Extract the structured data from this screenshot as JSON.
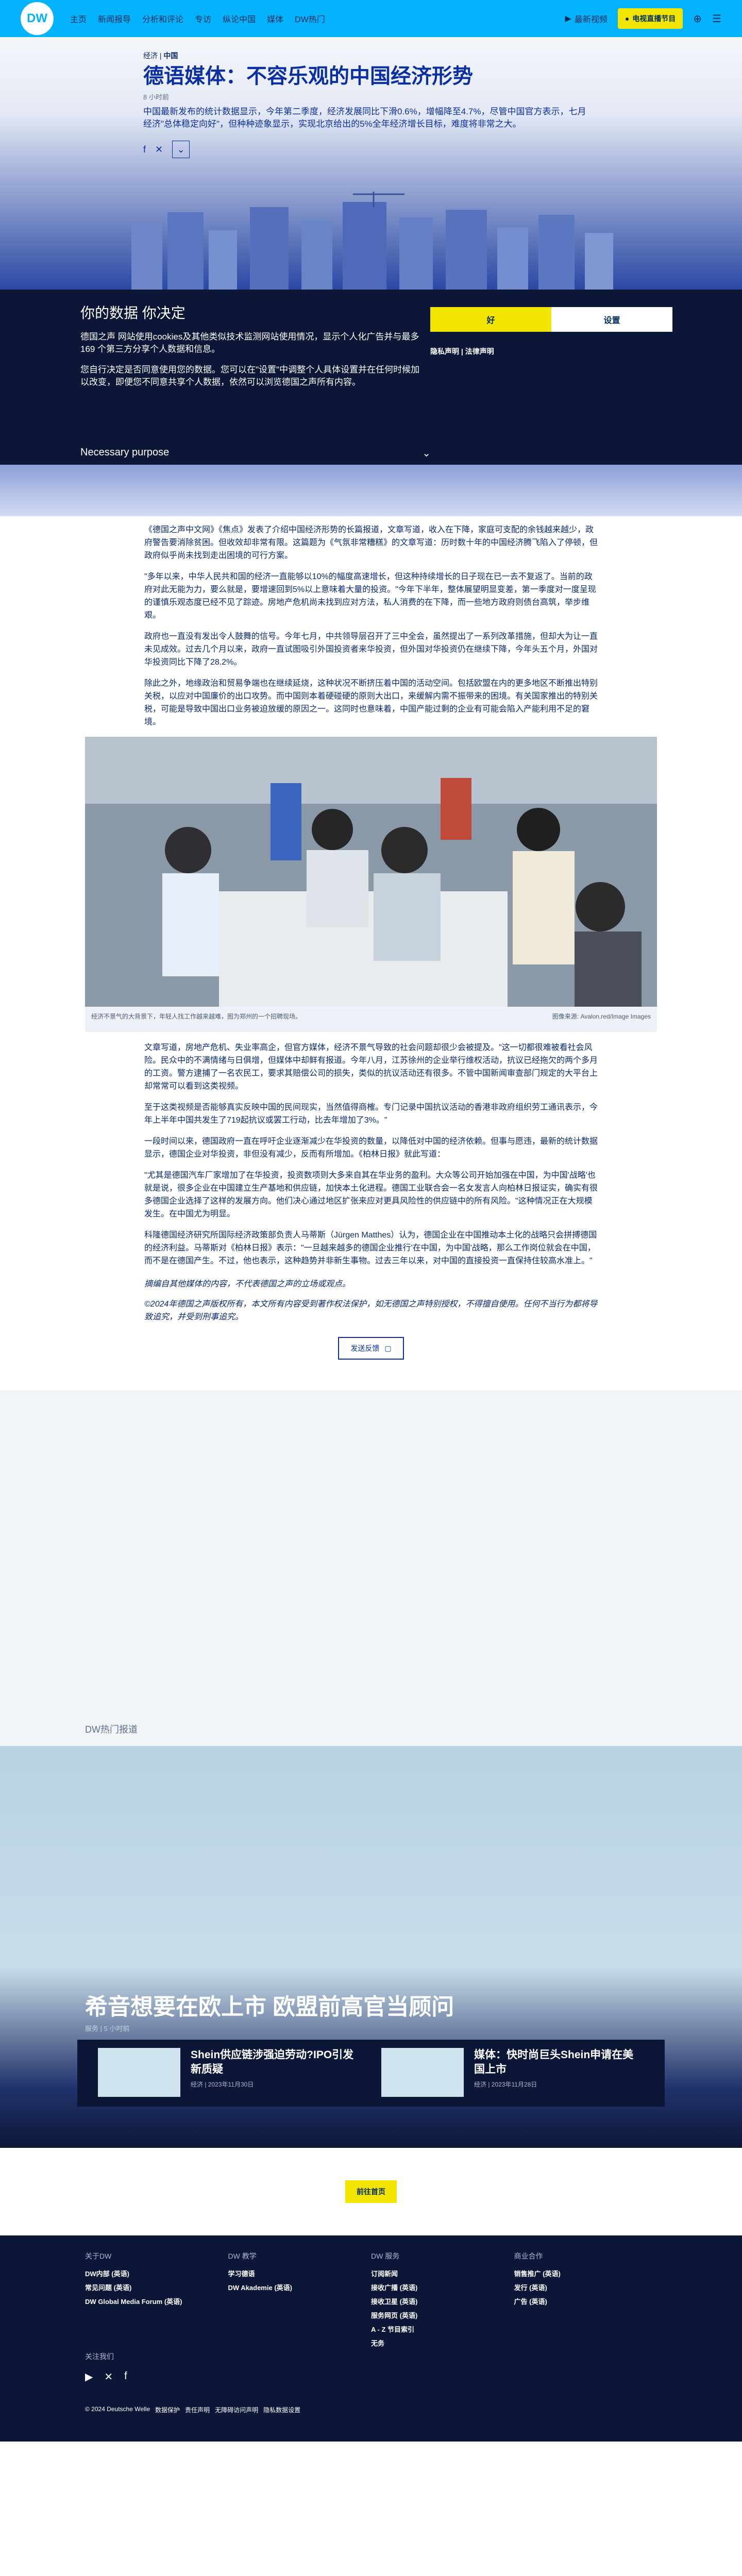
{
  "header": {
    "logo": "DW",
    "nav": [
      "主页",
      "新闻报导",
      "分析和评论",
      "专访",
      "纵论中国",
      "媒体",
      "DW热门"
    ],
    "latest": "最新视频",
    "live": "电视直播节目"
  },
  "article": {
    "kicker_section": "经济",
    "kicker_country": "中国",
    "title": "德语媒体：不容乐观的中国经济形势",
    "date": "8 小时前",
    "lede": "中国最新发布的统计数据显示，今年第二季度，经济发展同比下滑0.6%，增幅降至4.7%，尽管中国官方表示，七月经济\"总体稳定向好\"，但种种迹象显示，实现北京给出的5%全年经济增长目标，难度将非常之大。",
    "paragraphs": [
      "《德国之声中文网》《焦点》发表了介绍中国经济形势的长篇报道，文章写道，收入在下降，家庭可支配的余钱越来越少，政府警告要消除贫困。但收效却非常有限。这篇题为《气氛非常糟糕》的文章写道：历时数十年的中国经济腾飞陷入了停顿，但政府似乎尚未找到走出困境的可行方案。",
      "\"多年以来，中华人民共和国的经济一直能够以10%的幅度高速增长，但这种持续增长的日子现在已一去不复返了。当前的政府对此无能为力，要么就是，要增速回到5%以上意味着大量的投资。\"今年下半年，整体展望明显变差，第一季度对一度呈现的谨慎乐观态度已经不见了踪迹。房地产危机尚未找到应对方法，私人消费的在下降，而一些地方政府则债台高筑，举步维艰。",
      "政府也一直没有发出令人鼓舞的信号。今年七月，中共领导层召开了三中全会，虽然提出了一系列改革措施，但却大为让一直未见成效。过去几个月以来，政府一直试图吸引外国投资者来华投资，但外国对华投资仍在继续下降，今年头五个月，外国对华投资同比下降了28.2%。",
      "除此之外，地缘政治和贸易争端也在继续延烧，这种状况不断挤压着中国的活动空间。包括欧盟在内的更多地区不断推出特别关税，以应对中国廉价的出口攻势。而中国则本着硬碰硬的原则大出口，来缓解内需不振带来的困境。有关国家推出的特别关税，可能是导致中国出口业务被迫放缓的原因之一。这同时也意味着，中国产能过剩的企业有可能会陷入产能利用不足的窘境。"
    ],
    "photo_caption": "经济不景气的大背景下，年轻人找工作越来越难，图为郑州的一个招聘现场。",
    "photo_credit": "图像来源: Avalon.red/Image Images",
    "paragraphs2": [
      "文章写道，房地产危机、失业率高企，但官方媒体，经济不景气导致的社会问题却很少会被提及。\"这一切都很难被看社会风险。民众中的不满情绪与日俱增，但媒体中却鲜有报道。今年八月，江苏徐州的企业举行维权活动，抗议已经拖欠的两个多月的工资。警方逮捕了一名农民工，要求其赔偿公司的损失，类似的抗议活动还有很多。不管中国新闻审查部门规定的大平台上却常常可以看到这类视频。",
      "至于这类视频是否能够真实反映中国的民间现实，当然值得商榷。专门记录中国抗议活动的香港非政府组织劳工通讯表示，今年上半年中国共发生了719起抗议或罢工行动，比去年增加了3%。\"",
      "一段时间以来，德国政府一直在呼吁企业逐渐减少在华投资的数量，以降低对中国的经济依赖。但事与愿违，最新的统计数据显示，德国企业对华投资，非但没有减少，反而有所增加。《柏林日报》就此写道：",
      "\"尤其是德国汽车厂家增加了在华投资，投资数项则大多来自其在华业务的盈利。大众等公司开始加强在中国，为中国'战略'也就是说，很多企业在中国建立生产基地和供应链，加快本土化进程。德国工业联合会一名女发言人向柏林日报证实，确实有很多德国企业选择了这样的发展方向。他们决心通过地区扩张来应对更具风险性的供应链中的所有风险。\"这种情况正在大规模发生。在中国尤为明显。",
      "科隆德国经济研究所国际经济政策部负责人马蒂斯（Jürgen Matthes）认为，德国企业在中国推动本土化的战略只会拼搏德国的经济利益。马蒂斯对《柏林日报》表示：\"一旦越来越多的德国企业推行'在中国，为中国'战略，那么工作岗位就会在中国，而不是在德国产生。不过，他也表示，这种趋势并非新生事物。过去三年以来，对中国的直接投资一直保持住较高水准上。\""
    ],
    "disclaimer": [
      "摘编自其他媒体的内容，不代表德国之声的立场或观点。",
      "©2024年德国之声版权所有，本文所有内容受到著作权法保护，如无德国之声特别授权，不得擅自使用。任何不当行为都将导致追究，并受到刑事追究。"
    ],
    "feedback": "发送反馈"
  },
  "consent": {
    "title": "你的数据 你决定",
    "p1": "德国之声 网站使用cookies及其他类似技术监测网站使用情况，显示个人化广告并与最多169 个第三方分享个人数据和信息。",
    "p2": "您自行决定是否同意使用您的数据。您可以在\"设置\"中调整个人具体设置并在任何时候加以改变，即便您不同意共享个人数据，依然可以浏览德国之声所有内容。",
    "purpose": "Necessary purpose",
    "accept": "好",
    "settings": "设置",
    "links": "隐私声明 | 法律声明"
  },
  "related": {
    "section": "DW热门报道",
    "main_title": "希音想要在欧上市 欧盟前高官当顾问",
    "main_meta": "服务 | 5 小时前",
    "cards": [
      {
        "title": "Shein供应链涉强迫劳动?IPO引发新质疑",
        "meta": "经济 | 2023年11月30日"
      },
      {
        "title": "媒体：快时尚巨头Shein申请在美国上市",
        "meta": "经济 | 2023年11月28日"
      }
    ]
  },
  "back_to_top": "前往首页",
  "footer": {
    "cols": [
      {
        "title": "关于DW",
        "items": [
          "DW内部 (英语)",
          "常见问题 (英语)",
          "DW Global Media Forum (英语)"
        ]
      },
      {
        "title": "DW 教学",
        "items": [
          "学习德语",
          "DW Akademie (英语)"
        ]
      },
      {
        "title": "DW 服务",
        "items": [
          "订阅新闻",
          "接收广播 (英语)",
          "接收卫星 (英语)",
          "服务网页 (英语)",
          "A - Z 节目索引",
          "无务"
        ]
      },
      {
        "title": "商业合作",
        "items": [
          "销售推广 (英语)",
          "发行 (英语)",
          "广告 (英语)"
        ]
      }
    ],
    "follow": "关注我们",
    "legal": [
      "© 2024 Deutsche Welle",
      "数据保护",
      "责任声明",
      "无障碍访问声明",
      "隐私数据设置"
    ]
  }
}
